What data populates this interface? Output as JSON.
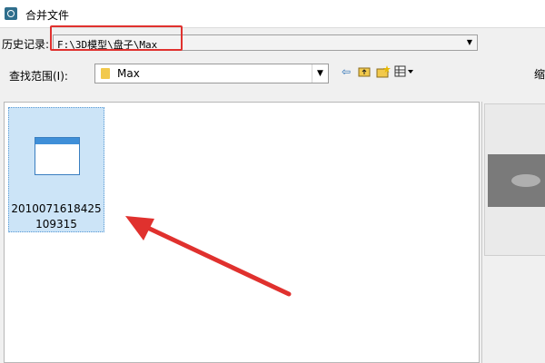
{
  "window": {
    "title": "合并文件",
    "icon": "app-icon"
  },
  "history": {
    "label": "历史记录:",
    "value": "F:\\3D模型\\盘子\\Max"
  },
  "lookin": {
    "label": "查找范围(I):",
    "value": "Max"
  },
  "toolbar": {
    "icons": [
      "back-arrow-icon",
      "up-folder-icon",
      "new-folder-icon",
      "view-menu-icon"
    ]
  },
  "right_label": "缩",
  "file_list": {
    "items": [
      {
        "name": "2010071618425109315"
      }
    ]
  },
  "colors": {
    "selection": "#cce4f7",
    "annotation_red": "#e0312e"
  }
}
